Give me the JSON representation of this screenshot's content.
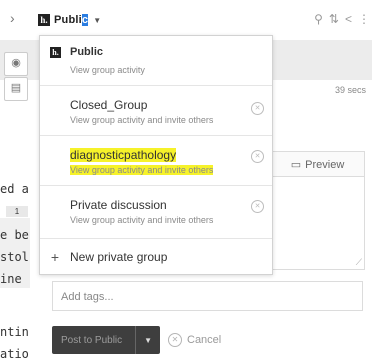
{
  "topbar": {
    "chevron_icon": "chevron-right-icon",
    "brand_prefix": "Publi",
    "brand_selected": "c",
    "caret_icon": "caret-down-icon",
    "icons": [
      "search-icon",
      "sort-icon",
      "share-icon",
      "menu-icon"
    ]
  },
  "annotation": {
    "time_ago": "39 secs"
  },
  "page_fragments": [
    "ed a",
    "e be",
    "stol",
    "ine",
    "ntin",
    "atio"
  ],
  "page_badge": "1",
  "editor": {
    "preview_label": "Preview",
    "preview_icon": "preview-icon"
  },
  "tags": {
    "placeholder": "Add tags..."
  },
  "post": {
    "label": "Post to Public",
    "cancel_label": "Cancel"
  },
  "dropdown": {
    "items": [
      {
        "name": "Public",
        "sub": "View group activity",
        "bold": true
      },
      {
        "name": "Closed_Group",
        "sub": "View group activity and invite others"
      },
      {
        "name": "diagnosticpathology",
        "sub": "View group activity and invite others",
        "highlighted": true
      },
      {
        "name": "Private discussion",
        "sub": "View group activity and invite others"
      }
    ],
    "new_group_label": "New private group"
  },
  "colors": {
    "highlight": "#f6f22a",
    "selection": "#2a7de1"
  }
}
